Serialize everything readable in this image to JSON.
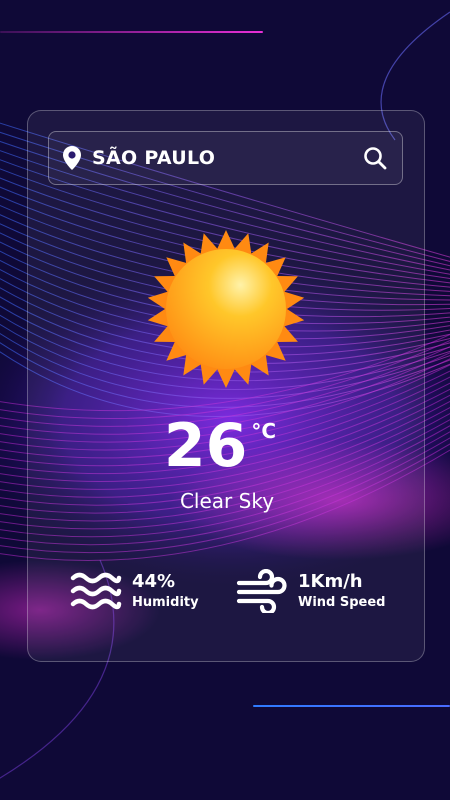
{
  "location": {
    "city": "SÃO PAULO"
  },
  "icons": {
    "location": "location-pin-icon",
    "search": "search-icon",
    "weather": "sun-icon",
    "humidity": "waves-icon",
    "wind": "wind-icon"
  },
  "weather": {
    "temperature": "26",
    "unit": "°C",
    "condition": "Clear Sky"
  },
  "stats": {
    "humidity": {
      "value": "44%",
      "label": "Humidity"
    },
    "wind": {
      "value": "1Km/h",
      "label": "Wind Speed"
    }
  },
  "colors": {
    "background": "#0e0838",
    "accent_pink": "#e92fd8",
    "accent_blue": "#2f7bff",
    "sun_core": "#ffb21d",
    "sun_rays": "#ff8a12",
    "text": "#ffffff"
  }
}
